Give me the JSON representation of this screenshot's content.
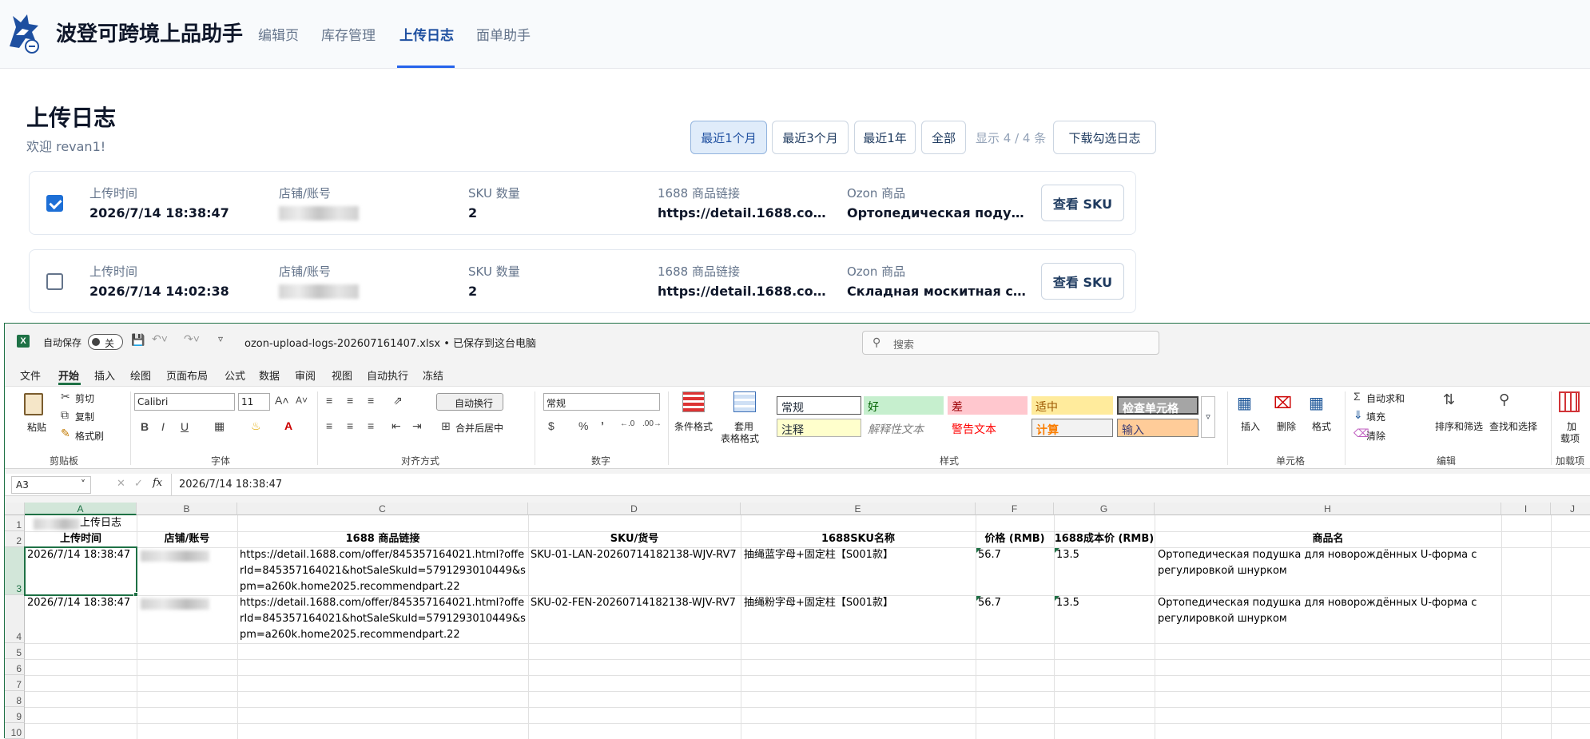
{
  "app": {
    "brand": "波登可跨境上品助手",
    "nav": [
      {
        "label": "编辑页"
      },
      {
        "label": "库存管理"
      },
      {
        "label": "上传日志",
        "active": true
      },
      {
        "label": "面单助手"
      }
    ],
    "accent_color": "#2563eb"
  },
  "page": {
    "title": "上传日志",
    "welcome": "欢迎 revan1!",
    "filters": [
      "最近1个月",
      "最近3个月",
      "最近1年",
      "全部"
    ],
    "active_filter": "最近1个月",
    "count_text": "显示 4 / 4 条",
    "download_label": "下载勾选日志"
  },
  "cards": [
    {
      "checked": true,
      "time_label": "上传时间",
      "time": "2026/7/14 18:38:47",
      "shop_label": "店铺/账号",
      "sku_label": "SKU 数量",
      "sku_count": "2",
      "link_label": "1688 商品链接",
      "link": "https://detail.1688.com/off...",
      "ozon_label": "Ozon 商品",
      "ozon": "Ортопедическая подушка...",
      "button": "查看 SKU"
    },
    {
      "checked": false,
      "time_label": "上传时间",
      "time": "2026/7/14 14:02:38",
      "shop_label": "店铺/账号",
      "sku_label": "SKU 数量",
      "sku_count": "2",
      "link_label": "1688 商品链接",
      "link": "https://detail.1688.com/off...",
      "ozon_label": "Ozon 商品",
      "ozon": "Складная москитная сетк...",
      "button": "查看 SKU"
    }
  ],
  "excel": {
    "autosave_label": "自动保存",
    "autosave_state": "关",
    "filename": "ozon-upload-logs-202607161407.xlsx • 已保存到这台电脑",
    "search_placeholder": "搜索",
    "menu": [
      "文件",
      "开始",
      "插入",
      "绘图",
      "页面布局",
      "公式",
      "数据",
      "审阅",
      "视图",
      "自动执行",
      "冻结"
    ],
    "active_menu": "开始",
    "clipboard": {
      "paste": "粘贴",
      "cut": "剪切",
      "copy": "复制",
      "format_painter": "格式刷",
      "group": "剪贴板"
    },
    "font": {
      "name": "Calibri",
      "size": "11",
      "group": "字体"
    },
    "align": {
      "wrap": "自动换行",
      "merge": "合并后居中",
      "group": "对齐方式"
    },
    "number": {
      "format": "常规",
      "group": "数字"
    },
    "styles": {
      "conditional": "条件格式",
      "table_format_1": "套用",
      "table_format_2": "表格格式",
      "cells": [
        "常规",
        "好",
        "差",
        "适中",
        "检查单元格",
        "注释",
        "解释性文本",
        "警告文本",
        "计算",
        "输入"
      ],
      "group": "样式"
    },
    "cells_group": {
      "insert": "插入",
      "delete": "删除",
      "format": "格式",
      "group": "单元格"
    },
    "edit_group": {
      "autosum": "自动求和",
      "fill": "填充",
      "clear": "清除",
      "sort": "排序和筛选",
      "find": "查找和选择",
      "group": "编辑"
    },
    "addins": {
      "label_1": "加",
      "label_2": "载项",
      "group": "加载项"
    },
    "name_box": "A3",
    "formula": "2026/7/14 18:38:47",
    "columns": [
      "A",
      "B",
      "C",
      "D",
      "E",
      "F",
      "G",
      "H",
      "I",
      "J"
    ],
    "rows": [
      "1",
      "2",
      "3",
      "4",
      "5",
      "6",
      "7",
      "8",
      "9",
      "10"
    ],
    "title_cell": "上传日志",
    "headers": [
      "上传时间",
      "店铺/账号",
      "1688 商品链接",
      "SKU/货号",
      "1688SKU名称",
      "价格 (RMB)",
      "1688成本价 (RMB)",
      "商品名"
    ],
    "data_rows": [
      {
        "time": "2026/7/14 18:38:47",
        "link": "https://detail.1688.com/offer/845357164021.html?offerId=845357164021&hotSaleSkuId=5791293010449&spm=a260k.home2025.recommendpart.22",
        "sku": "SKU-01-LAN-20260714182138-WJV-RV7",
        "sku_name": "抽绳蓝字母+固定柱【S001款】",
        "price": "56.7",
        "cost": "13.5",
        "product": "Ортопедическая подушка для новорождённых U-форма с регулировкой шнурком"
      },
      {
        "time": "2026/7/14 18:38:47",
        "link": "https://detail.1688.com/offer/845357164021.html?offerId=845357164021&hotSaleSkuId=5791293010449&spm=a260k.home2025.recommendpart.22",
        "sku": "SKU-02-FEN-20260714182138-WJV-RV7",
        "sku_name": "抽绳粉字母+固定柱【S001款】",
        "price": "56.7",
        "cost": "13.5",
        "product": "Ортопедическая подушка для новорождённых U-форма с регулировкой шнурком"
      }
    ]
  }
}
